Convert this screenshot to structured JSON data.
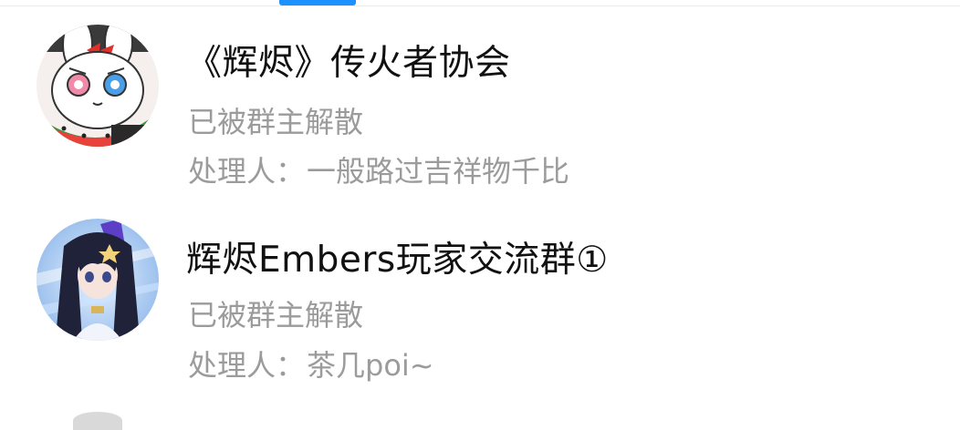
{
  "groups": [
    {
      "name": "《辉烬》传火者协会",
      "status": "已被群主解散",
      "handler_label": "处理人：",
      "handler_name": "一般路过吉祥物千比",
      "avatar_icon": "white-rabbit-with-watermelon-avatar"
    },
    {
      "name": "辉烬Embers玩家交流群①",
      "status": "已被群主解散",
      "handler_label": "处理人：",
      "handler_name": "茶几poi~",
      "avatar_icon": "anime-girl-dark-hair-avatar"
    }
  ],
  "colors": {
    "accent": "#1e90ff",
    "title": "#111111",
    "secondary": "#9b9b9b"
  }
}
